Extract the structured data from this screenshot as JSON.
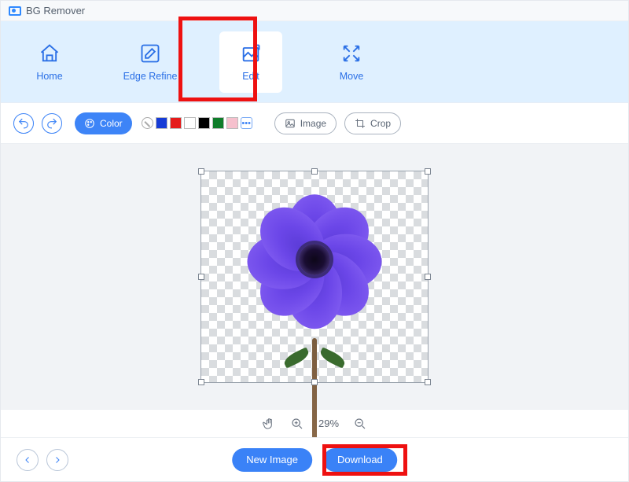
{
  "app": {
    "title": "BG Remover"
  },
  "toolbar": {
    "home": {
      "label": "Home",
      "icon": "home-icon"
    },
    "edge": {
      "label": "Edge Refine",
      "icon": "edit-square-icon"
    },
    "edit": {
      "label": "Edit",
      "icon": "crop-image-icon",
      "active": true
    },
    "move": {
      "label": "Move",
      "icon": "move-arrows-icon"
    }
  },
  "subbar": {
    "undo_icon": "undo-icon",
    "redo_icon": "redo-icon",
    "color_button": "Color",
    "swatches": [
      "none",
      "#163bd6",
      "#e51b1b",
      "#ffffff",
      "#000000",
      "#0f7d2a",
      "#f6c0cd",
      "more"
    ],
    "image_button": "Image",
    "crop_button": "Crop"
  },
  "zoom": {
    "value": "29%"
  },
  "footer": {
    "new_image": "New Image",
    "download": "Download"
  }
}
